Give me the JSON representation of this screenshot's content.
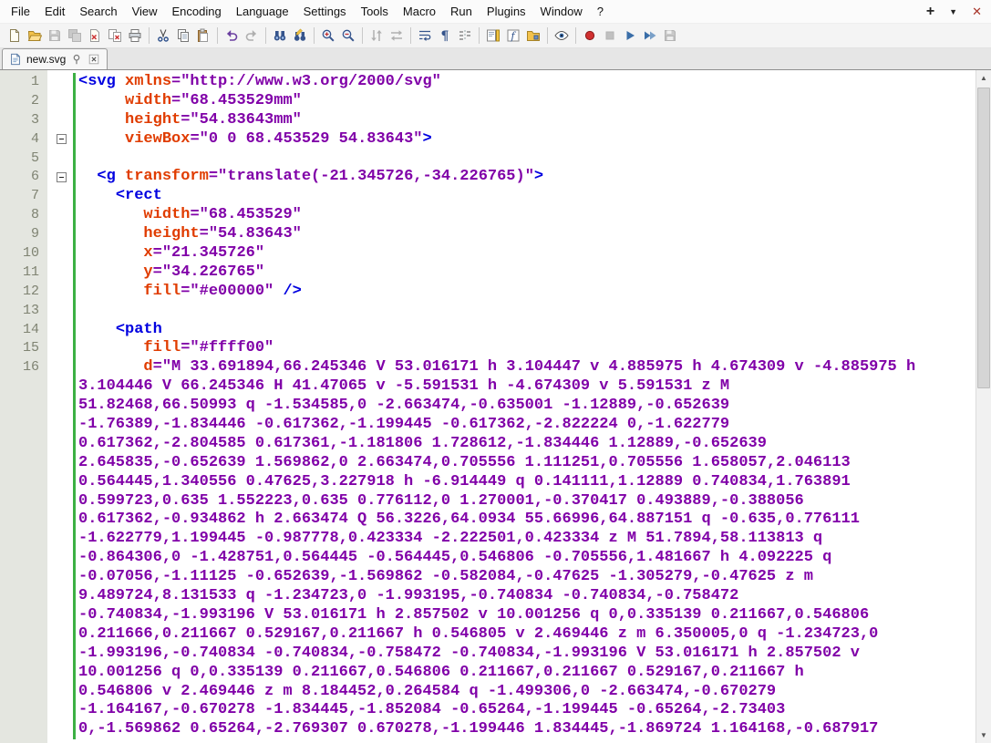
{
  "menu": {
    "items": [
      "File",
      "Edit",
      "Search",
      "View",
      "Encoding",
      "Language",
      "Settings",
      "Tools",
      "Macro",
      "Run",
      "Plugins",
      "Window",
      "?"
    ],
    "window_buttons": {
      "plus": "+",
      "dropdown": "▼",
      "close": "✕"
    }
  },
  "toolbar": {
    "buttons": [
      {
        "name": "new-file"
      },
      {
        "name": "open-file"
      },
      {
        "name": "save",
        "disabled": true
      },
      {
        "name": "save-all",
        "disabled": true
      },
      {
        "name": "close"
      },
      {
        "name": "close-all"
      },
      {
        "name": "print"
      },
      {
        "name": "separator"
      },
      {
        "name": "cut"
      },
      {
        "name": "copy"
      },
      {
        "name": "paste"
      },
      {
        "name": "separator"
      },
      {
        "name": "undo"
      },
      {
        "name": "redo",
        "disabled": true
      },
      {
        "name": "separator"
      },
      {
        "name": "find"
      },
      {
        "name": "replace"
      },
      {
        "name": "separator"
      },
      {
        "name": "zoom-in"
      },
      {
        "name": "zoom-out"
      },
      {
        "name": "separator"
      },
      {
        "name": "sync-vertical",
        "disabled": true
      },
      {
        "name": "sync-horizontal",
        "disabled": true
      },
      {
        "name": "separator"
      },
      {
        "name": "word-wrap"
      },
      {
        "name": "show-all-characters"
      },
      {
        "name": "indent-guide"
      },
      {
        "name": "separator"
      },
      {
        "name": "document-map"
      },
      {
        "name": "function-list"
      },
      {
        "name": "folder-as-workspace"
      },
      {
        "name": "separator"
      },
      {
        "name": "monitoring"
      },
      {
        "name": "separator"
      },
      {
        "name": "macro-record"
      },
      {
        "name": "macro-stop",
        "disabled": true
      },
      {
        "name": "macro-play"
      },
      {
        "name": "macro-run-multiple"
      },
      {
        "name": "macro-save",
        "disabled": true
      }
    ]
  },
  "tabbar": {
    "tabs": [
      {
        "label": "new.svg",
        "active": true
      }
    ]
  },
  "colors": {
    "tag": "#0000e0",
    "attr": "#e03c00",
    "val": "#8000a8",
    "plain": "#000000",
    "chbar": "#3cb043",
    "lnfg": "#7f8372",
    "lnbg": "#e4e6e0"
  },
  "editor": {
    "scrollbar": {
      "up_glyph": "▲",
      "down_glyph": "▼"
    },
    "rows": [
      {
        "n": "1",
        "s": [
          [
            "t",
            "<svg"
          ],
          [
            "p",
            " "
          ],
          [
            "a",
            "xmlns"
          ],
          [
            "v",
            "=\"http://www.w3.org/2000/svg\""
          ]
        ]
      },
      {
        "n": "2",
        "s": [
          [
            "p",
            "     "
          ],
          [
            "a",
            "width"
          ],
          [
            "v",
            "=\"68.453529mm\""
          ]
        ]
      },
      {
        "n": "3",
        "s": [
          [
            "p",
            "     "
          ],
          [
            "a",
            "height"
          ],
          [
            "v",
            "=\"54.83643mm\""
          ]
        ]
      },
      {
        "n": "4",
        "f": true,
        "s": [
          [
            "p",
            "     "
          ],
          [
            "a",
            "viewBox"
          ],
          [
            "v",
            "=\"0 0 68.453529 54.83643\""
          ],
          [
            "t",
            ">"
          ]
        ]
      },
      {
        "n": "5",
        "s": []
      },
      {
        "n": "6",
        "f": true,
        "s": [
          [
            "p",
            "  "
          ],
          [
            "t",
            "<g"
          ],
          [
            "p",
            " "
          ],
          [
            "a",
            "transform"
          ],
          [
            "v",
            "=\"translate(-21.345726,-34.226765)\""
          ],
          [
            "t",
            ">"
          ]
        ]
      },
      {
        "n": "7",
        "s": [
          [
            "p",
            "    "
          ],
          [
            "t",
            "<rect"
          ]
        ]
      },
      {
        "n": "8",
        "s": [
          [
            "p",
            "       "
          ],
          [
            "a",
            "width"
          ],
          [
            "v",
            "=\"68.453529\""
          ]
        ]
      },
      {
        "n": "9",
        "s": [
          [
            "p",
            "       "
          ],
          [
            "a",
            "height"
          ],
          [
            "v",
            "=\"54.83643\""
          ]
        ]
      },
      {
        "n": "10",
        "s": [
          [
            "p",
            "       "
          ],
          [
            "a",
            "x"
          ],
          [
            "v",
            "=\"21.345726\""
          ]
        ]
      },
      {
        "n": "11",
        "s": [
          [
            "p",
            "       "
          ],
          [
            "a",
            "y"
          ],
          [
            "v",
            "=\"34.226765\""
          ]
        ]
      },
      {
        "n": "12",
        "s": [
          [
            "p",
            "       "
          ],
          [
            "a",
            "fill"
          ],
          [
            "v",
            "=\"#e00000\""
          ],
          [
            "p",
            " "
          ],
          [
            "t",
            "/>"
          ]
        ]
      },
      {
        "n": "13",
        "s": []
      },
      {
        "n": "14",
        "s": [
          [
            "p",
            "    "
          ],
          [
            "t",
            "<path"
          ]
        ]
      },
      {
        "n": "15",
        "s": [
          [
            "p",
            "       "
          ],
          [
            "a",
            "fill"
          ],
          [
            "v",
            "=\"#ffff00\""
          ]
        ]
      },
      {
        "n": "16",
        "s": [
          [
            "p",
            "       "
          ],
          [
            "a",
            "d"
          ],
          [
            "v",
            "=\"M 33.691894,66.245346 V 53.016171 h 3.104447 v 4.885975 h 4.674309 v -4.885975 h"
          ]
        ]
      },
      {
        "n": "",
        "s": [
          [
            "v",
            "3.104446 V 66.245346 H 41.47065 v -5.591531 h -4.674309 v 5.591531 z M"
          ]
        ]
      },
      {
        "n": "",
        "s": [
          [
            "v",
            "51.82468,66.50993 q -1.534585,0 -2.663474,-0.635001 -1.12889,-0.652639"
          ]
        ]
      },
      {
        "n": "",
        "s": [
          [
            "v",
            "-1.76389,-1.834446 -0.617362,-1.199445 -0.617362,-2.822224 0,-1.622779"
          ]
        ]
      },
      {
        "n": "",
        "s": [
          [
            "v",
            "0.617362,-2.804585 0.617361,-1.181806 1.728612,-1.834446 1.12889,-0.652639"
          ]
        ]
      },
      {
        "n": "",
        "s": [
          [
            "v",
            "2.645835,-0.652639 1.569862,0 2.663474,0.705556 1.111251,0.705556 1.658057,2.046113"
          ]
        ]
      },
      {
        "n": "",
        "s": [
          [
            "v",
            "0.564445,1.340556 0.47625,3.227918 h -6.914449 q 0.141111,1.12889 0.740834,1.763891"
          ]
        ]
      },
      {
        "n": "",
        "s": [
          [
            "v",
            "0.599723,0.635 1.552223,0.635 0.776112,0 1.270001,-0.370417 0.493889,-0.388056"
          ]
        ]
      },
      {
        "n": "",
        "s": [
          [
            "v",
            "0.617362,-0.934862 h 2.663474 Q 56.3226,64.0934 55.66996,64.887151 q -0.635,0.776111"
          ]
        ]
      },
      {
        "n": "",
        "s": [
          [
            "v",
            "-1.622779,1.199445 -0.987778,0.423334 -2.222501,0.423334 z M 51.7894,58.113813 q"
          ]
        ]
      },
      {
        "n": "",
        "s": [
          [
            "v",
            "-0.864306,0 -1.428751,0.564445 -0.564445,0.546806 -0.705556,1.481667 h 4.092225 q"
          ]
        ]
      },
      {
        "n": "",
        "s": [
          [
            "v",
            "-0.07056,-1.11125 -0.652639,-1.569862 -0.582084,-0.47625 -1.305279,-0.47625 z m"
          ]
        ]
      },
      {
        "n": "",
        "s": [
          [
            "v",
            "9.489724,8.131533 q -1.234723,0 -1.993195,-0.740834 -0.740834,-0.758472"
          ]
        ]
      },
      {
        "n": "",
        "s": [
          [
            "v",
            "-0.740834,-1.993196 V 53.016171 h 2.857502 v 10.001256 q 0,0.335139 0.211667,0.546806"
          ]
        ]
      },
      {
        "n": "",
        "s": [
          [
            "v",
            "0.211666,0.211667 0.529167,0.211667 h 0.546805 v 2.469446 z m 6.350005,0 q -1.234723,0"
          ]
        ]
      },
      {
        "n": "",
        "s": [
          [
            "v",
            "-1.993196,-0.740834 -0.740834,-0.758472 -0.740834,-1.993196 V 53.016171 h 2.857502 v"
          ]
        ]
      },
      {
        "n": "",
        "s": [
          [
            "v",
            "10.001256 q 0,0.335139 0.211667,0.546806 0.211667,0.211667 0.529167,0.211667 h"
          ]
        ]
      },
      {
        "n": "",
        "s": [
          [
            "v",
            "0.546806 v 2.469446 z m 8.184452,0.264584 q -1.499306,0 -2.663474,-0.670279"
          ]
        ]
      },
      {
        "n": "",
        "s": [
          [
            "v",
            "-1.164167,-0.670278 -1.834445,-1.852084 -0.65264,-1.199445 -0.65264,-2.73403"
          ]
        ]
      },
      {
        "n": "",
        "s": [
          [
            "v",
            "0,-1.569862 0.65264,-2.769307 0.670278,-1.199446 1.834445,-1.869724 1.164168,-0.687917"
          ]
        ]
      }
    ]
  }
}
